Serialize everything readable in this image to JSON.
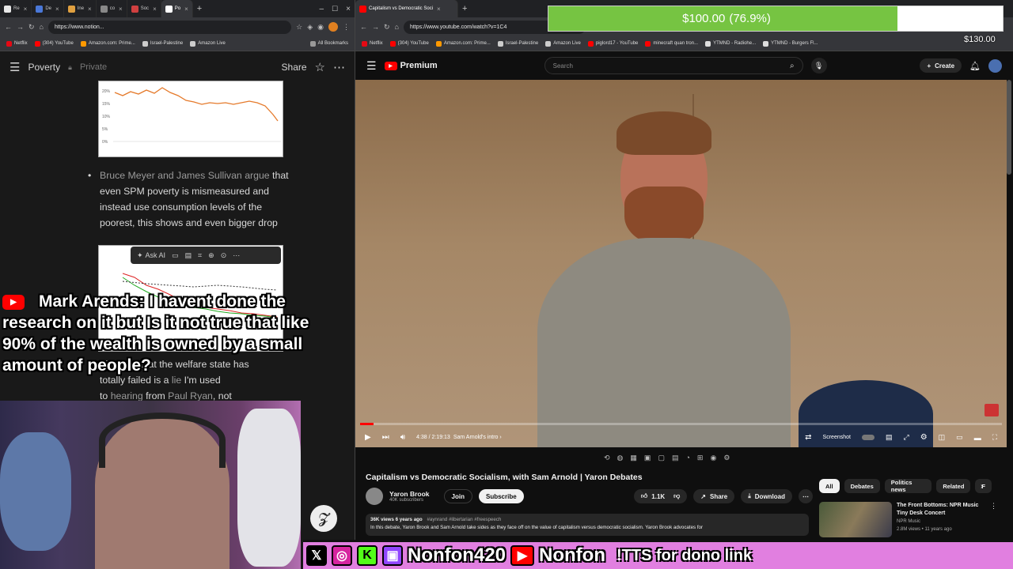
{
  "left_browser": {
    "tabs": [
      {
        "label": "Re",
        "color": "#e8e8e8"
      },
      {
        "label": "De",
        "color": "#4a78d8"
      },
      {
        "label": "Ine",
        "color": "#e0a040"
      },
      {
        "label": "co",
        "color": "#aaaaaa"
      },
      {
        "label": "Soc",
        "color": "#d04040"
      },
      {
        "label": "Po",
        "color": "#ffffff"
      }
    ],
    "url": "https://www.notion...",
    "bookmarks": [
      "Netflix",
      "(304) YouTube",
      "Amazon.com: Prime...",
      "Israel-Palestine",
      "Amazon Live"
    ],
    "all_bookmarks": "All Bookmarks"
  },
  "notion": {
    "title": "Poverty",
    "privacy": "Private",
    "share": "Share",
    "chart1_yticks": [
      "20%",
      "15%",
      "10%",
      "5%",
      "0%"
    ],
    "bullet_author": "Bruce Meyer and James Sullivan",
    "bullet_link": "argue",
    "bullet_text": " that even SPM poverty is mismeasured and instead use consumption levels of the poorest, this shows and even bigger drop",
    "ai_toolbar_label": "Ask AI",
    "para_partial_1": "The idea that the welfare state has",
    "para_partial_2": "totally failed is a",
    "para_lie": "lie",
    "para_partial_3": " I'm used",
    "para_partial_4": "to",
    "para_hearing": "hearing",
    "para_from": " from ",
    "para_paul": "Paul Ryan",
    "para_not": ", not"
  },
  "chat_message": {
    "author": "Mark Arends:",
    "text": "I havent done the research on it but Is it not true that like 90% of the wealth is owned by a small amount of people?"
  },
  "right_browser": {
    "tab": "Capitalism vs Democratic Soci",
    "url": "https://www.youtube.com/watch?v=1C4",
    "bookmarks": [
      "Netflix",
      "(304) YouTube",
      "Amazon.com: Prime...",
      "Israel-Palestine",
      "Amazon Live",
      "piglord17 - YouTube",
      "minecraft quan tron...",
      "YTMND - Radiohe...",
      "YTMND - Burgers Fl..."
    ]
  },
  "donation_goal": {
    "amount": "$100.00",
    "percent_text": "(76.9%)",
    "fraction": 0.769,
    "goal": "$130.00"
  },
  "youtube": {
    "logo": "Premium",
    "search_placeholder": "Search",
    "create": "Create",
    "time": "4:38 / 2:19:13",
    "chapter": "Sam Arnold's intro",
    "progress_fraction": 0.021,
    "screenshot_label": "Screenshot",
    "video_title": "Capitalism vs Democratic Socialism, with Sam Arnold | Yaron Debates",
    "channel": "Yaron Brook",
    "subscribers": "40K subscribers",
    "join": "Join",
    "subscribe": "Subscribe",
    "likes": "1.1K",
    "share": "Share",
    "download": "Download",
    "views_line": "36K views  6 years ago",
    "hashtags": "#aynrand #libertarian #freespeech",
    "description": "In this debate, Yaron Brook and Sam Arnold take sides as they face off on the value of capitalism versus democratic socialism. Yaron Brook advocates for",
    "chips": [
      "All",
      "Debates",
      "Politics news",
      "Related",
      "F"
    ],
    "rec_title": "The Front Bottoms: NPR Music Tiny Desk Concert",
    "rec_channel": "NPR Music",
    "rec_meta": "2.8M views • 11 years ago"
  },
  "stream_banner": {
    "handle1": "Nonfon420",
    "handle2": "Nonfon",
    "tts": "!TTS for dono link"
  }
}
